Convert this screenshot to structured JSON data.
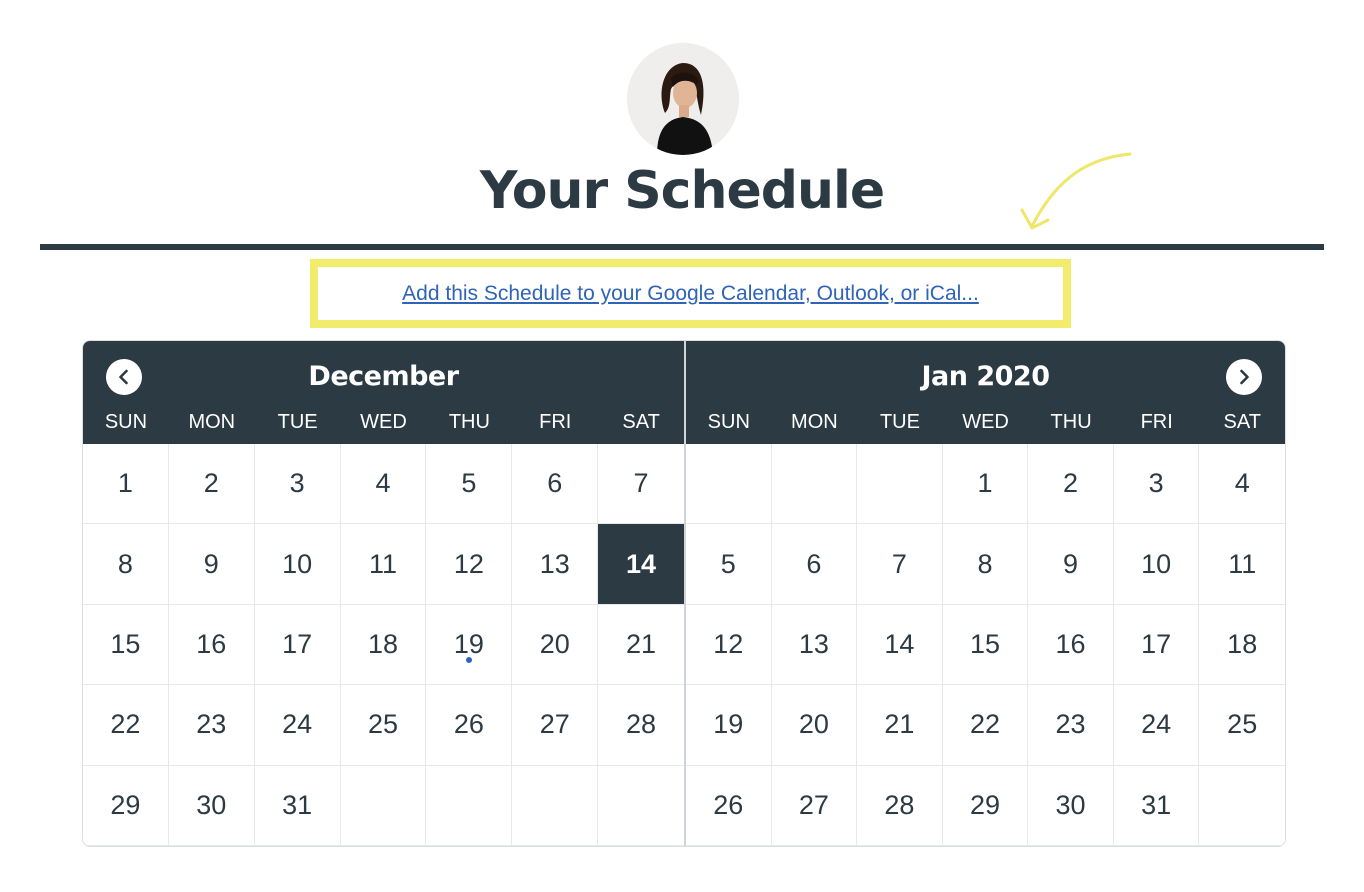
{
  "header": {
    "title": "Your Schedule",
    "avatar_icon": "user-avatar-photo",
    "sync_link": "Add this Schedule to your Google Calendar, Outlook, or iCal...",
    "highlight_color": "#f1ec6c",
    "annotation_icon": "curved-arrow-icon"
  },
  "colors": {
    "accent_dark": "#2c3a43",
    "link": "#2f64b8",
    "event_dot": "#2f64b8"
  },
  "calendar": {
    "weekdays": [
      "SUN",
      "MON",
      "TUE",
      "WED",
      "THU",
      "FRI",
      "SAT"
    ],
    "prev_icon": "chevron-left-icon",
    "next_icon": "chevron-right-icon",
    "months": [
      {
        "title": "December",
        "cells": [
          "1",
          "2",
          "3",
          "4",
          "5",
          "6",
          "7",
          "8",
          "9",
          "10",
          "11",
          "12",
          "13",
          "14",
          "15",
          "16",
          "17",
          "18",
          "19",
          "20",
          "21",
          "22",
          "23",
          "24",
          "25",
          "26",
          "27",
          "28",
          "29",
          "30",
          "31",
          "",
          "",
          "",
          ""
        ],
        "selected": "14",
        "events": [
          "19"
        ]
      },
      {
        "title": "Jan 2020",
        "cells": [
          "",
          "",
          "",
          "1",
          "2",
          "3",
          "4",
          "5",
          "6",
          "7",
          "8",
          "9",
          "10",
          "11",
          "12",
          "13",
          "14",
          "15",
          "16",
          "17",
          "18",
          "19",
          "20",
          "21",
          "22",
          "23",
          "24",
          "25",
          "26",
          "27",
          "28",
          "29",
          "30",
          "31",
          ""
        ],
        "selected": "",
        "events": []
      }
    ]
  }
}
